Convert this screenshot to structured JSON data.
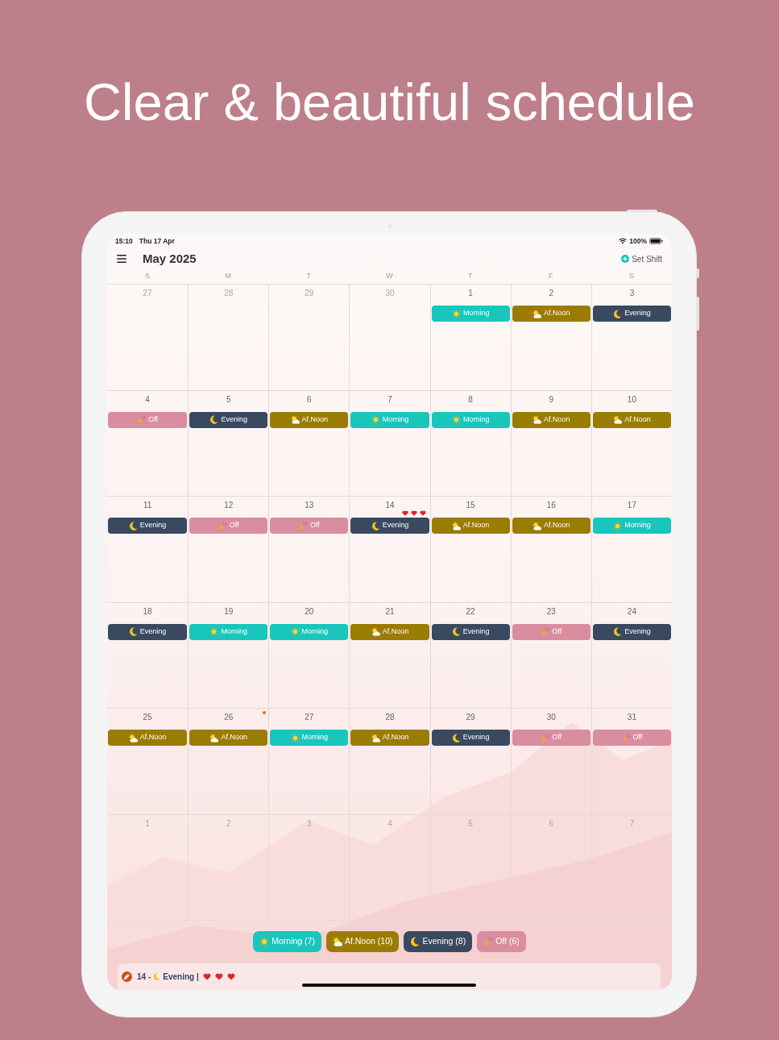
{
  "headline": "Clear & beautiful schedule",
  "status_bar": {
    "time": "15:10",
    "date": "Thu 17 Apr",
    "battery": "100%"
  },
  "header": {
    "title": "May 2025",
    "action": "Set Shift"
  },
  "weekdays": [
    "S",
    "M",
    "T",
    "W",
    "T",
    "F",
    "S"
  ],
  "weeks": [
    {
      "days": [
        {
          "day": "27",
          "in_month": false
        },
        {
          "day": "28",
          "in_month": false
        },
        {
          "day": "29",
          "in_month": false
        },
        {
          "day": "30",
          "in_month": false
        },
        {
          "day": "1",
          "in_month": true,
          "shift": {
            "kind": "morning",
            "label": "Morning"
          }
        },
        {
          "day": "2",
          "in_month": true,
          "shift": {
            "kind": "afternoon",
            "label": "Af.Noon"
          }
        },
        {
          "day": "3",
          "in_month": true,
          "shift": {
            "kind": "evening",
            "label": "Evening"
          }
        }
      ]
    },
    {
      "days": [
        {
          "day": "4",
          "in_month": true,
          "shift": {
            "kind": "off",
            "label": "Off"
          }
        },
        {
          "day": "5",
          "in_month": true,
          "shift": {
            "kind": "evening",
            "label": "Evening"
          }
        },
        {
          "day": "6",
          "in_month": true,
          "shift": {
            "kind": "afternoon",
            "label": "Af.Noon"
          }
        },
        {
          "day": "7",
          "in_month": true,
          "shift": {
            "kind": "morning",
            "label": "Morning"
          }
        },
        {
          "day": "8",
          "in_month": true,
          "shift": {
            "kind": "morning",
            "label": "Morning"
          }
        },
        {
          "day": "9",
          "in_month": true,
          "shift": {
            "kind": "afternoon",
            "label": "Af.Noon"
          }
        },
        {
          "day": "10",
          "in_month": true,
          "shift": {
            "kind": "afternoon",
            "label": "Af.Noon"
          }
        }
      ]
    },
    {
      "days": [
        {
          "day": "11",
          "in_month": true,
          "shift": {
            "kind": "evening",
            "label": "Evening"
          }
        },
        {
          "day": "12",
          "in_month": true,
          "shift": {
            "kind": "off",
            "label": "Off"
          }
        },
        {
          "day": "13",
          "in_month": true,
          "shift": {
            "kind": "off",
            "label": "Off"
          }
        },
        {
          "day": "14",
          "in_month": true,
          "shift": {
            "kind": "evening",
            "label": "Evening"
          },
          "marks": [
            {
              "kind": "heart"
            },
            {
              "kind": "heart"
            },
            {
              "kind": "heart"
            }
          ]
        },
        {
          "day": "15",
          "in_month": true,
          "shift": {
            "kind": "afternoon",
            "label": "Af.Noon"
          }
        },
        {
          "day": "16",
          "in_month": true,
          "shift": {
            "kind": "afternoon",
            "label": "Af.Noon"
          }
        },
        {
          "day": "17",
          "in_month": true,
          "shift": {
            "kind": "morning",
            "label": "Morning"
          }
        }
      ]
    },
    {
      "days": [
        {
          "day": "18",
          "in_month": true,
          "shift": {
            "kind": "evening",
            "label": "Evening"
          }
        },
        {
          "day": "19",
          "in_month": true,
          "shift": {
            "kind": "morning",
            "label": "Morning"
          }
        },
        {
          "day": "20",
          "in_month": true,
          "shift": {
            "kind": "morning",
            "label": "Morning"
          }
        },
        {
          "day": "21",
          "in_month": true,
          "shift": {
            "kind": "afternoon",
            "label": "Af.Noon"
          }
        },
        {
          "day": "22",
          "in_month": true,
          "shift": {
            "kind": "evening",
            "label": "Evening"
          }
        },
        {
          "day": "23",
          "in_month": true,
          "shift": {
            "kind": "off",
            "label": "Off"
          }
        },
        {
          "day": "24",
          "in_month": true,
          "shift": {
            "kind": "evening",
            "label": "Evening"
          }
        }
      ]
    },
    {
      "days": [
        {
          "day": "25",
          "in_month": true,
          "shift": {
            "kind": "afternoon",
            "label": "Af.Noon"
          }
        },
        {
          "day": "26",
          "in_month": true,
          "shift": {
            "kind": "afternoon",
            "label": "Af.Noon"
          },
          "marks": [
            {
              "kind": "dot"
            }
          ]
        },
        {
          "day": "27",
          "in_month": true,
          "shift": {
            "kind": "morning",
            "label": "Morning"
          }
        },
        {
          "day": "28",
          "in_month": true,
          "shift": {
            "kind": "afternoon",
            "label": "Af.Noon"
          }
        },
        {
          "day": "29",
          "in_month": true,
          "shift": {
            "kind": "evening",
            "label": "Evening"
          }
        },
        {
          "day": "30",
          "in_month": true,
          "shift": {
            "kind": "off",
            "label": "Off"
          }
        },
        {
          "day": "31",
          "in_month": true,
          "shift": {
            "kind": "off",
            "label": "Off"
          }
        }
      ]
    },
    {
      "days": [
        {
          "day": "1",
          "in_month": false
        },
        {
          "day": "2",
          "in_month": false
        },
        {
          "day": "3",
          "in_month": false
        },
        {
          "day": "4",
          "in_month": false
        },
        {
          "day": "5",
          "in_month": false
        },
        {
          "day": "6",
          "in_month": false
        },
        {
          "day": "7",
          "in_month": false
        }
      ]
    }
  ],
  "legend": [
    {
      "kind": "morning",
      "label": "Morning (7)",
      "color": "#19c6bc"
    },
    {
      "kind": "afternoon",
      "label": "Af.Noon (10)",
      "color": "#9b7c03"
    },
    {
      "kind": "evening",
      "label": "Evening (8)",
      "color": "#39495f"
    },
    {
      "kind": "off",
      "label": "Off (6)",
      "color": "#d98d9f"
    }
  ],
  "note": {
    "day": "14 -",
    "shift": {
      "kind": "evening",
      "label": "Evening |"
    },
    "marks": [
      {
        "kind": "heart"
      },
      {
        "kind": "heart"
      },
      {
        "kind": "heart"
      }
    ]
  }
}
